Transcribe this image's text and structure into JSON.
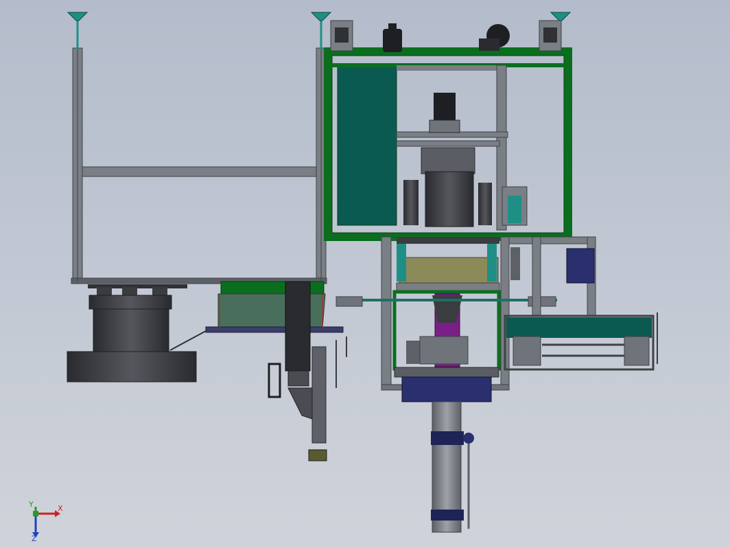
{
  "viewport": {
    "background_top": "#b4bccb",
    "background_bottom": "#cfd3da"
  },
  "colors": {
    "frame_green": "#0b6e1f",
    "panel_teal": "#0a5a52",
    "extrusion": "#6f737a",
    "dark_part": "#3a3c40",
    "purple_part": "#7a1f86",
    "navy_part": "#2a2f6e",
    "olive_panel": "#8d8a5a",
    "cyan_pole": "#1f8f86"
  },
  "triad": {
    "x_label": "X",
    "y_label": "Y",
    "z_label": "Z",
    "x_color": "#d02020",
    "y_color": "#20a020",
    "z_color": "#2040c0"
  }
}
